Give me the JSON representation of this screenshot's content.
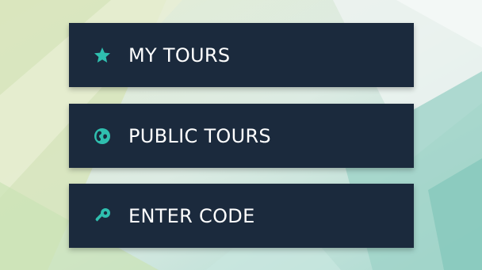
{
  "colors": {
    "button_bg": "#1b2a3d",
    "icon_accent": "#2fbfaf",
    "label_text": "#ffffff"
  },
  "menu": {
    "items": [
      {
        "label": "MY TOURS",
        "icon": "star-icon"
      },
      {
        "label": "PUBLIC TOURS",
        "icon": "globe-icon"
      },
      {
        "label": "ENTER CODE",
        "icon": "key-icon"
      }
    ]
  }
}
